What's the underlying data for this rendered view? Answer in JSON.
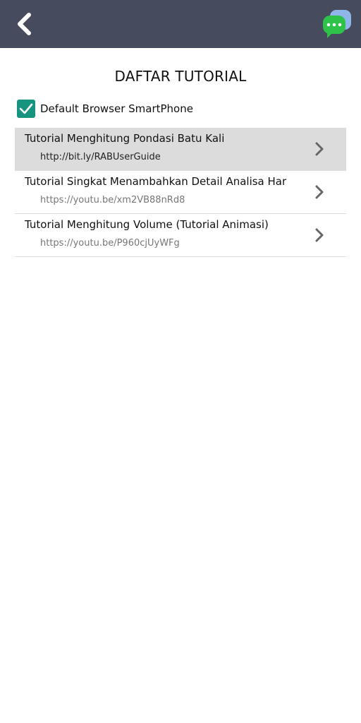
{
  "header": {
    "back_icon": "chevron-left-icon",
    "chat_icon": "chat-bubble-icon"
  },
  "page": {
    "title": "DAFTAR TUTORIAL"
  },
  "default_browser": {
    "label": "Default Browser SmartPhone",
    "checked": true
  },
  "tutorials": [
    {
      "title": "Tutorial Menghitung Pondasi Batu Kali",
      "url": "http://bit.ly/RABUserGuide",
      "selected": true
    },
    {
      "title": "Tutorial Singkat Menambahkan Detail Analisa Har",
      "url": "https://youtu.be/xm2VB88nRd8",
      "selected": false
    },
    {
      "title": "Tutorial Menghitung Volume (Tutorial Animasi)",
      "url": "https://youtu.be/P960cjUyWFg",
      "selected": false
    }
  ],
  "colors": {
    "header_bg": "#464b5e",
    "checkbox_accent": "#17947f",
    "chat_green": "#2ec24b",
    "chat_blue": "#8fb6e8"
  }
}
